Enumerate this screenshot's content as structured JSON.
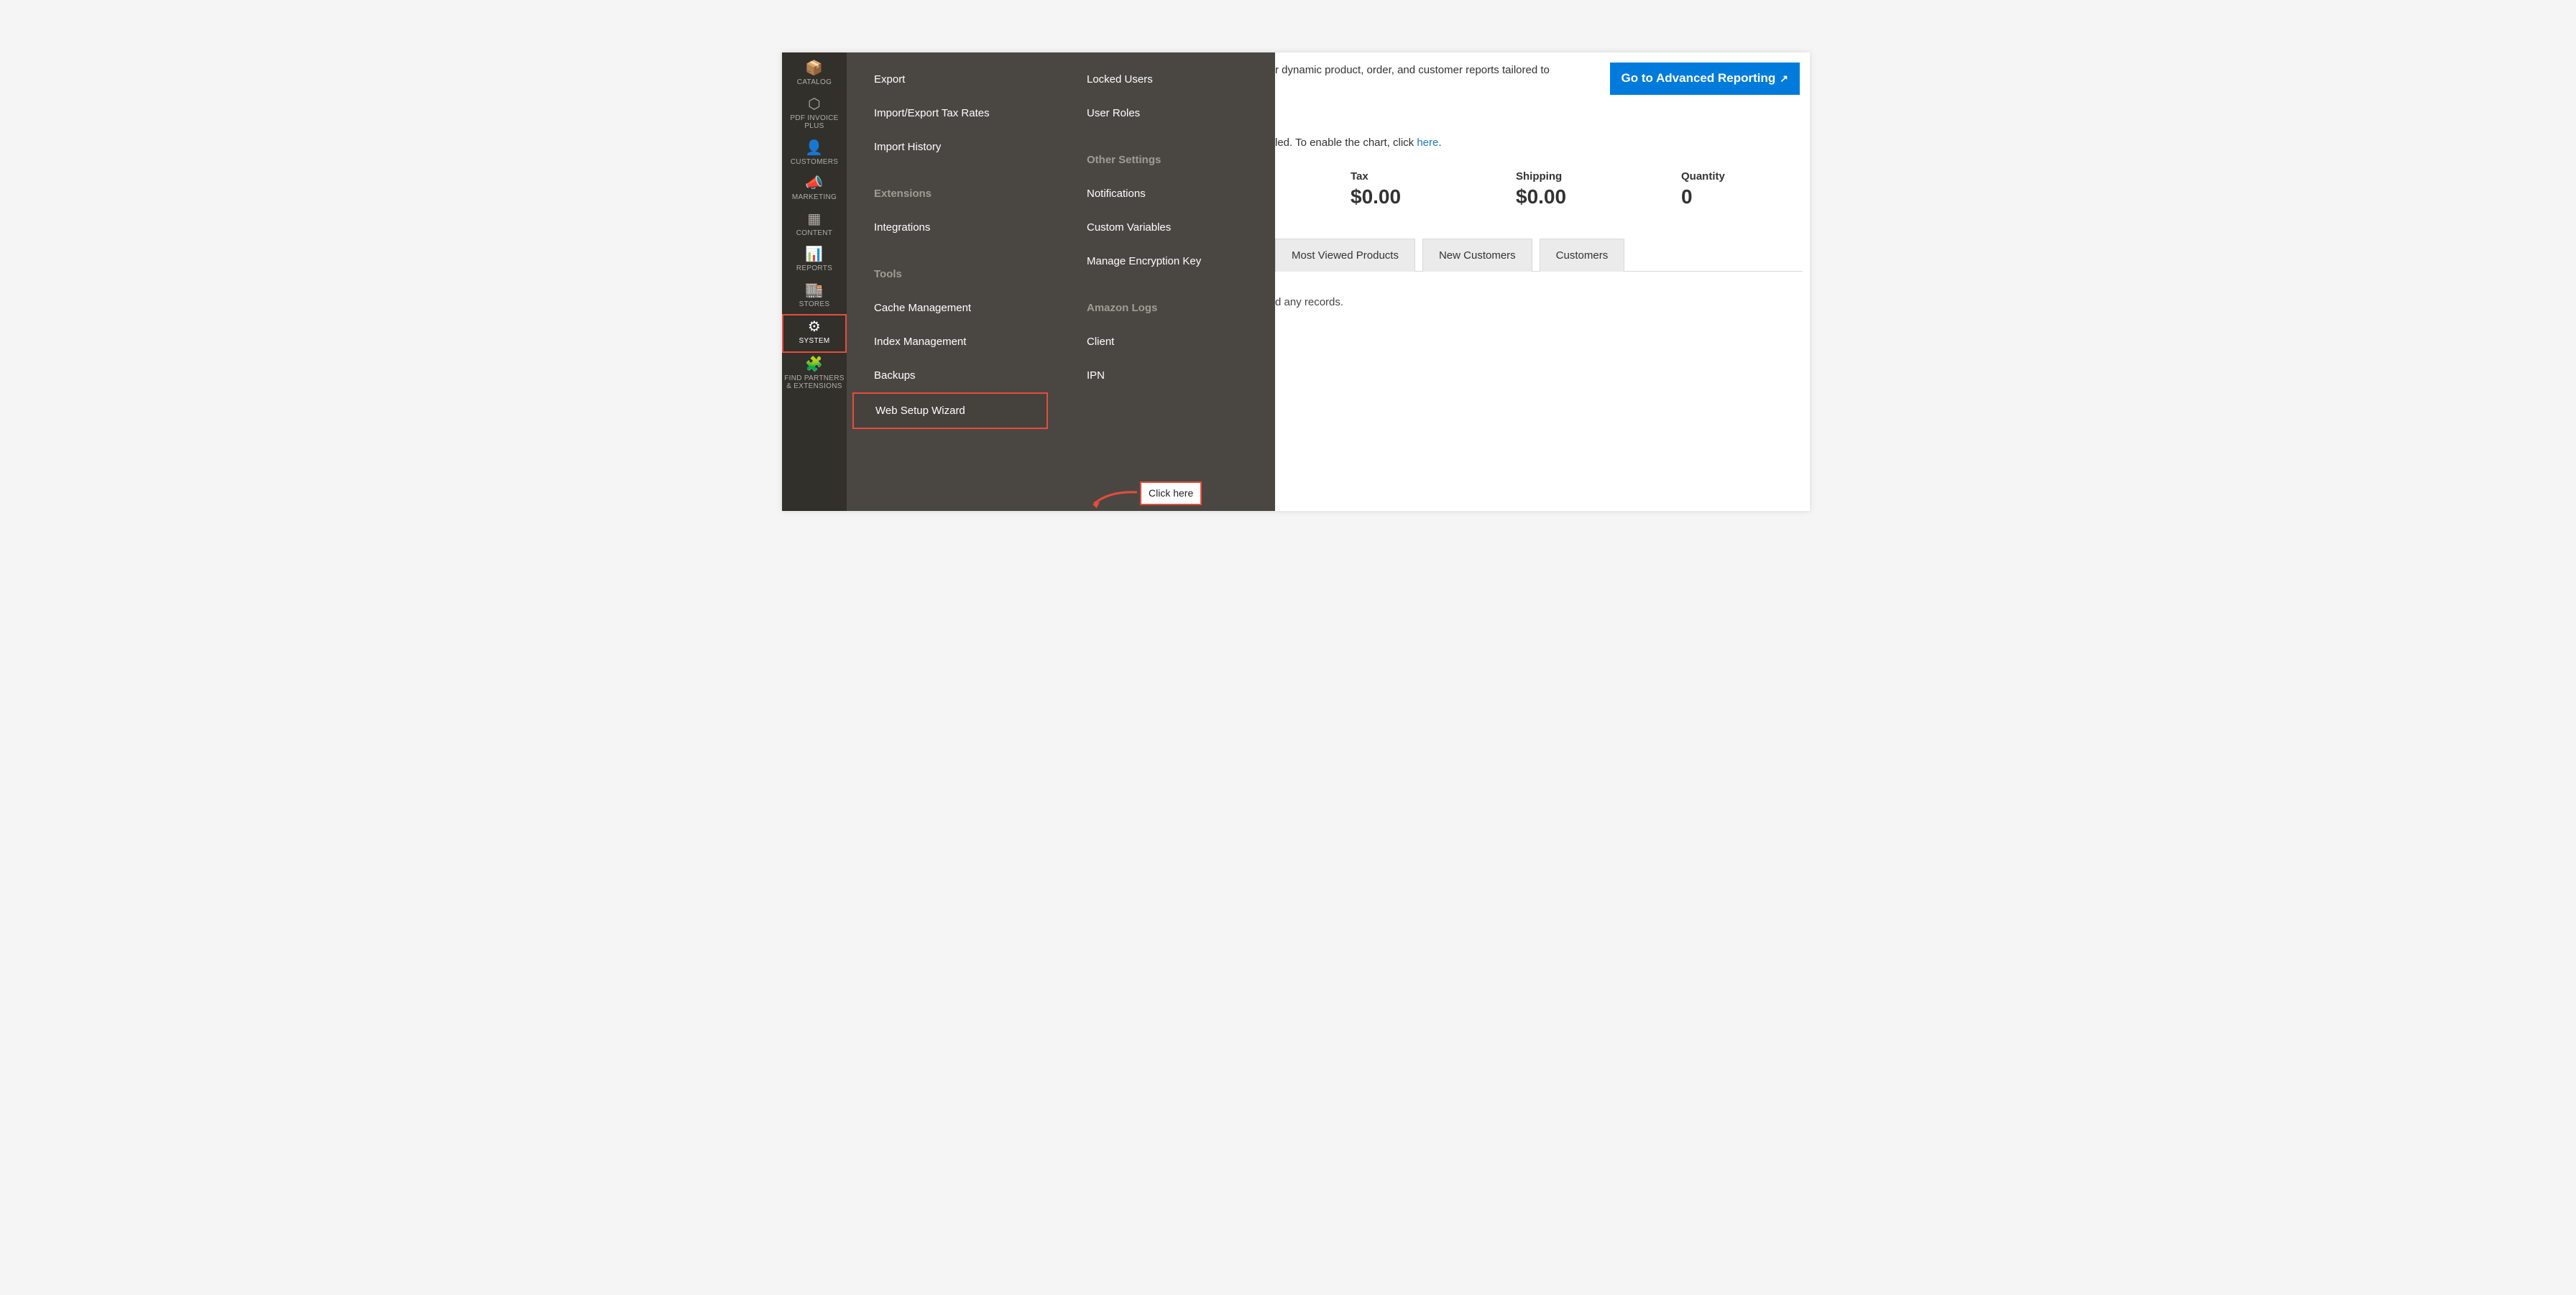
{
  "sidebar": {
    "items": [
      {
        "id": "catalog",
        "label": "CATALOG",
        "icon_name": "box-icon",
        "glyph": "📦"
      },
      {
        "id": "pdf",
        "label": "PDF INVOICE PLUS",
        "icon_name": "hexagon-icon",
        "glyph": "⬡"
      },
      {
        "id": "customers",
        "label": "CUSTOMERS",
        "icon_name": "person-icon",
        "glyph": "👤"
      },
      {
        "id": "marketing",
        "label": "MARKETING",
        "icon_name": "megaphone-icon",
        "glyph": "📣"
      },
      {
        "id": "content",
        "label": "CONTENT",
        "icon_name": "layout-icon",
        "glyph": "▦"
      },
      {
        "id": "reports",
        "label": "REPORTS",
        "icon_name": "bars-icon",
        "glyph": "📊"
      },
      {
        "id": "stores",
        "label": "STORES",
        "icon_name": "storefront-icon",
        "glyph": "🏬"
      },
      {
        "id": "system",
        "label": "SYSTEM",
        "icon_name": "gear-icon",
        "glyph": "⚙",
        "active": true,
        "highlighted": true
      },
      {
        "id": "partners",
        "label": "FIND PARTNERS & EXTENSIONS",
        "icon_name": "blocks-icon",
        "glyph": "🧩"
      }
    ]
  },
  "flyout": {
    "left": [
      {
        "type": "item",
        "id": "export",
        "label": "Export"
      },
      {
        "type": "item",
        "id": "ietax",
        "label": "Import/Export Tax Rates"
      },
      {
        "type": "item",
        "id": "imphist",
        "label": "Import History"
      },
      {
        "type": "spacer"
      },
      {
        "type": "header",
        "id": "extensions",
        "label": "Extensions"
      },
      {
        "type": "item",
        "id": "integrations",
        "label": "Integrations"
      },
      {
        "type": "spacer"
      },
      {
        "type": "header",
        "id": "tools",
        "label": "Tools"
      },
      {
        "type": "item",
        "id": "cache",
        "label": "Cache Management"
      },
      {
        "type": "item",
        "id": "index",
        "label": "Index Management"
      },
      {
        "type": "item",
        "id": "backups",
        "label": "Backups"
      },
      {
        "type": "item",
        "id": "wsw",
        "label": "Web Setup Wizard",
        "highlighted": true
      }
    ],
    "right": [
      {
        "type": "item",
        "id": "locked",
        "label": "Locked Users"
      },
      {
        "type": "item",
        "id": "roles",
        "label": "User Roles"
      },
      {
        "type": "spacer"
      },
      {
        "type": "header",
        "id": "other",
        "label": "Other Settings"
      },
      {
        "type": "item",
        "id": "notif",
        "label": "Notifications"
      },
      {
        "type": "item",
        "id": "vars",
        "label": "Custom Variables"
      },
      {
        "type": "item",
        "id": "enc",
        "label": "Manage Encryption Key"
      },
      {
        "type": "spacer"
      },
      {
        "type": "header",
        "id": "amazon",
        "label": "Amazon Logs"
      },
      {
        "type": "item",
        "id": "client",
        "label": "Client"
      },
      {
        "type": "item",
        "id": "ipn",
        "label": "IPN"
      }
    ]
  },
  "tooltip": {
    "text": "Click here"
  },
  "main": {
    "report_text_fragment": "r dynamic product, order, and customer reports tailored to",
    "go_button": "Go to Advanced Reporting",
    "chart_note_prefix": "led. To enable the chart, click ",
    "chart_note_link": "here",
    "chart_note_suffix": ".",
    "stats": [
      {
        "id": "tax",
        "label": "Tax",
        "value": "$0.00"
      },
      {
        "id": "shipping",
        "label": "Shipping",
        "value": "$0.00"
      },
      {
        "id": "quantity",
        "label": "Quantity",
        "value": "0"
      }
    ],
    "tabs": [
      {
        "id": "mostviewed",
        "label": "Most Viewed Products"
      },
      {
        "id": "newcust",
        "label": "New Customers"
      },
      {
        "id": "customers",
        "label": "Customers"
      }
    ],
    "no_records": "d any records."
  }
}
